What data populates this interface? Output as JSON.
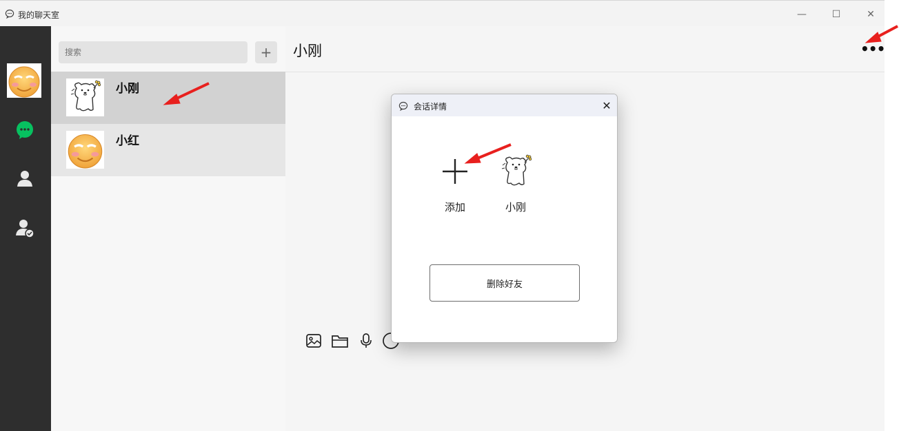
{
  "window": {
    "title": "我的聊天室",
    "minimize_glyph": "—",
    "maximize_glyph": "☐",
    "close_glyph": "✕"
  },
  "nav": {
    "items": [
      "chat-bubble-icon",
      "contacts-icon",
      "verified-user-icon"
    ],
    "accent_color": "#07c160"
  },
  "contacts": {
    "search_placeholder": "搜索",
    "add_glyph": "+",
    "items": [
      {
        "name": "小刚",
        "avatar": "white-bear-avatar",
        "selected": true
      },
      {
        "name": "小红",
        "avatar": "smiley-face-avatar",
        "selected": false
      }
    ]
  },
  "chat": {
    "title": "小刚",
    "more_glyph": "•••",
    "toolbar": [
      "image-icon",
      "folder-icon",
      "microphone-icon",
      "emoji-icon"
    ]
  },
  "dialog": {
    "title": "会话详情",
    "close_glyph": "✕",
    "members": [
      {
        "label": "添加",
        "icon": "plus-icon"
      },
      {
        "label": "小刚",
        "icon": "white-bear-avatar"
      }
    ],
    "delete_button": "删除好友"
  },
  "annotations": {
    "arrow_color": "#e8201e"
  }
}
